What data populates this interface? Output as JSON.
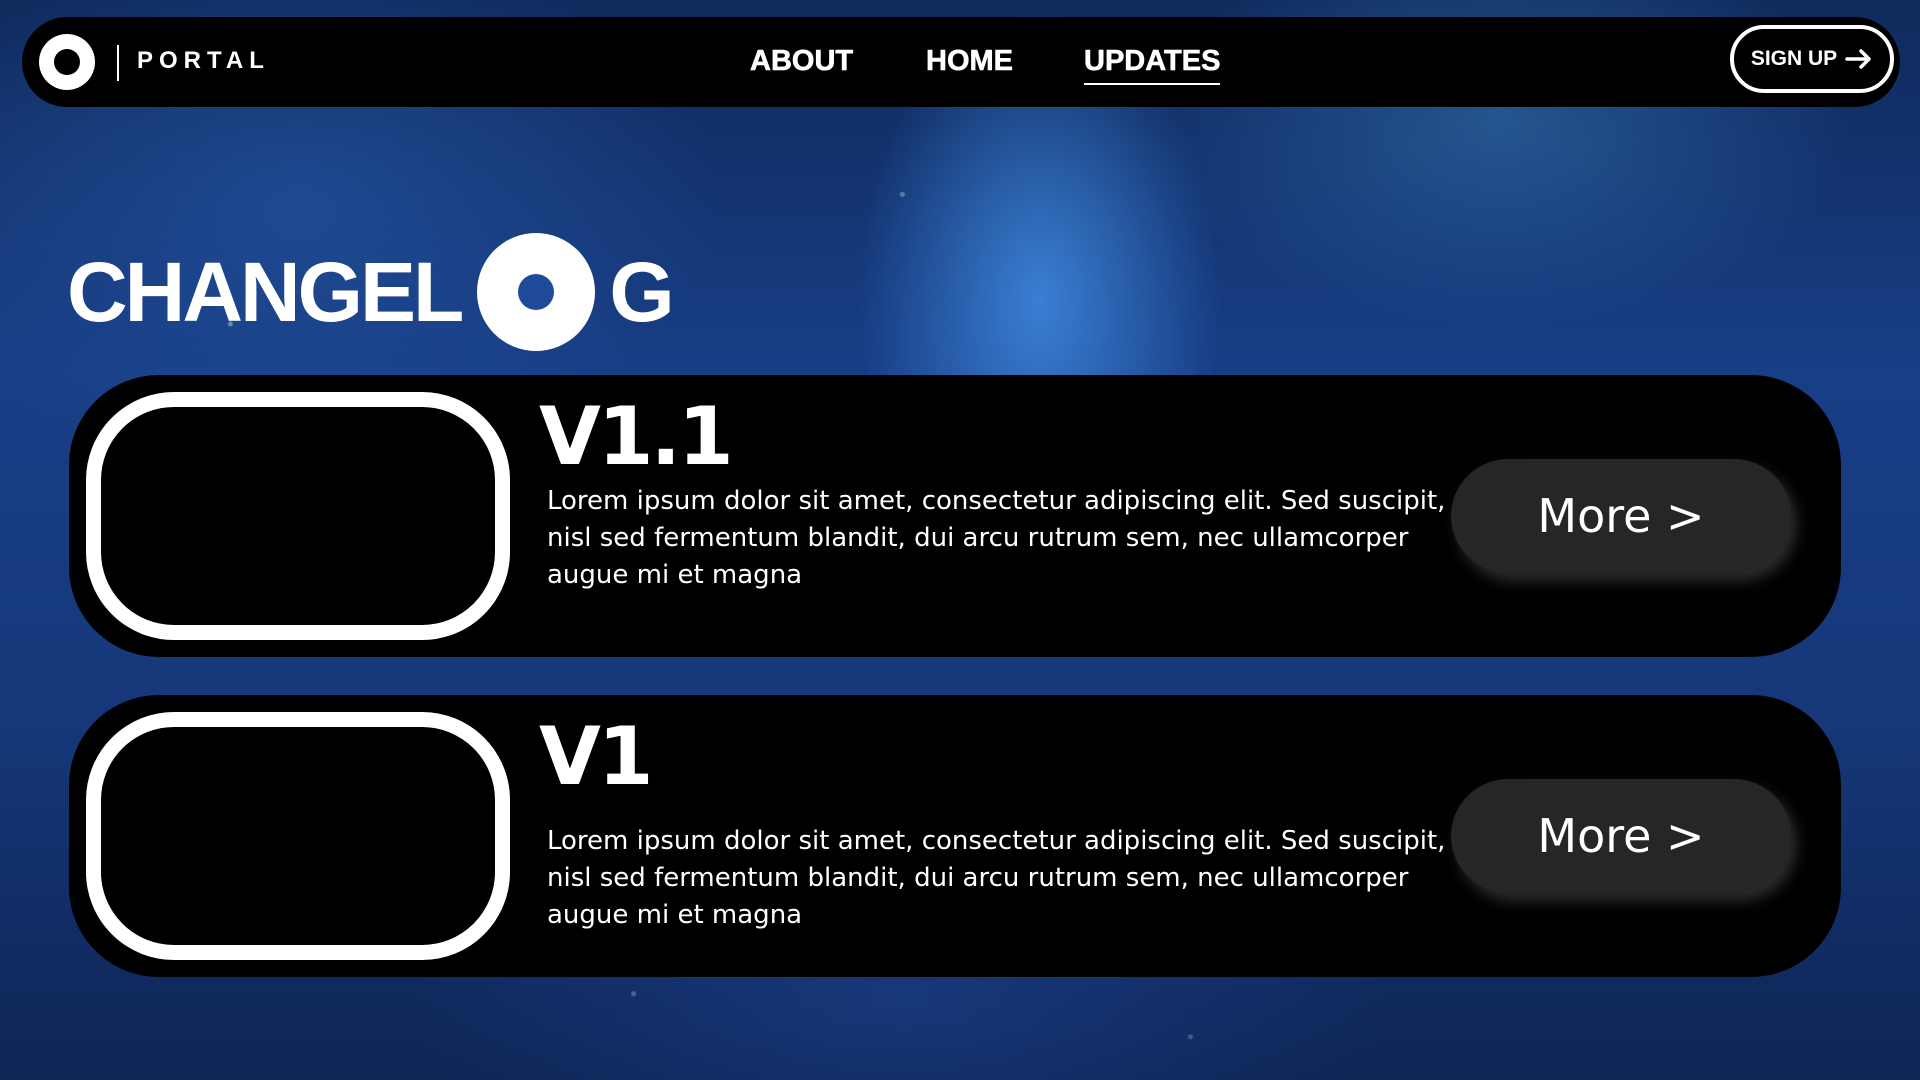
{
  "brand": {
    "name": "PORTAL"
  },
  "nav": {
    "links": [
      "ABOUT",
      "HOME",
      "UPDATES"
    ],
    "active": "UPDATES",
    "signup_label": "SIGN UP"
  },
  "title": {
    "prefix": "CHANGEL",
    "suffix": "G"
  },
  "entries": [
    {
      "version": "V1.1",
      "description": "Lorem ipsum dolor sit amet, consectetur adipiscing elit. Sed suscipit, nisl sed fermentum blandit, dui arcu rutrum sem, nec ullamcorper augue mi et magna",
      "button_label": "More >"
    },
    {
      "version": "V1",
      "description": "Lorem ipsum dolor sit amet, consectetur adipiscing elit. Sed suscipit, nisl sed fermentum blandit, dui arcu rutrum sem, nec ullamcorper augue mi et magna",
      "button_label": "More >"
    }
  ],
  "colors": {
    "background": "#183e86",
    "panel": "#000000",
    "button": "#262626",
    "text": "#ffffff"
  },
  "icons": [
    "portal-logo-icon",
    "arrow-right-icon",
    "changelog-o-icon"
  ]
}
